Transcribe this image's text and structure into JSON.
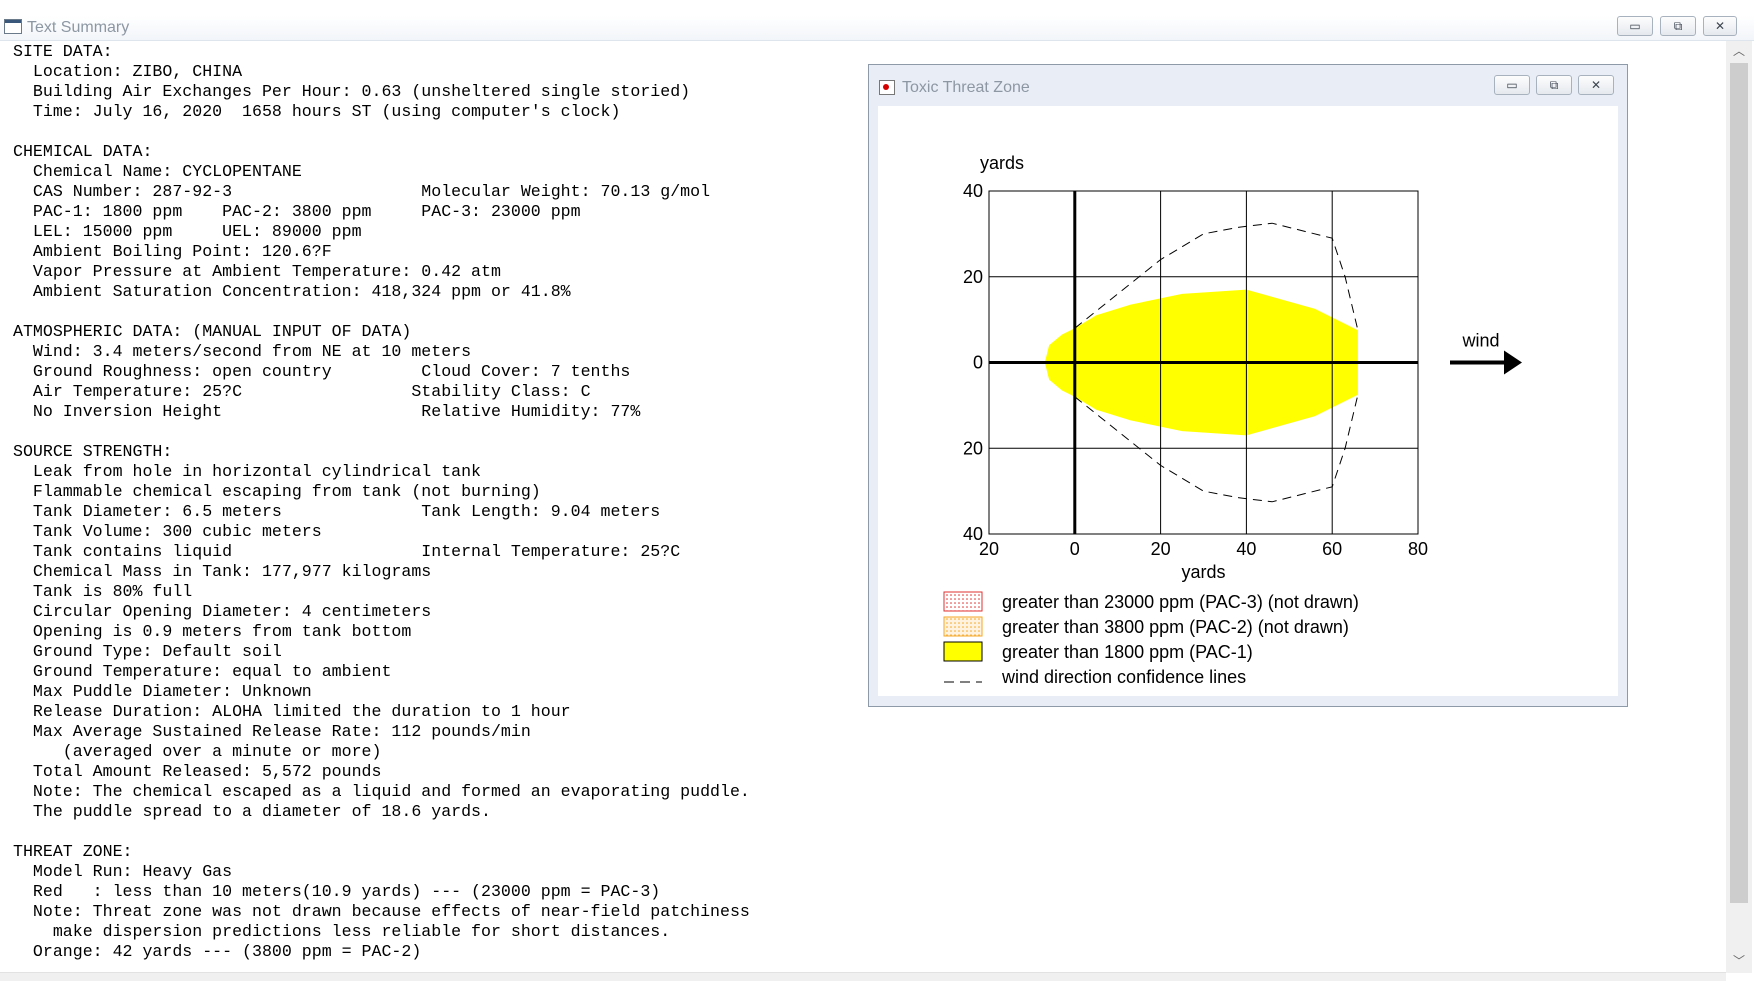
{
  "main_window": {
    "title": "Text Summary",
    "controls": {
      "minimize": "▭",
      "restore": "⧉",
      "close": "✕"
    }
  },
  "text_summary": {
    "lines": [
      "SITE DATA:",
      "  Location: ZIBO, CHINA",
      "  Building Air Exchanges Per Hour: 0.63 (unsheltered single storied)",
      "  Time: July 16, 2020  1658 hours ST (using computer's clock)",
      "",
      "CHEMICAL DATA:",
      "  Chemical Name: CYCLOPENTANE",
      "  CAS Number: 287-92-3                   Molecular Weight: 70.13 g/mol",
      "  PAC-1: 1800 ppm    PAC-2: 3800 ppm     PAC-3: 23000 ppm",
      "  LEL: 15000 ppm     UEL: 89000 ppm",
      "  Ambient Boiling Point: 120.6?F",
      "  Vapor Pressure at Ambient Temperature: 0.42 atm",
      "  Ambient Saturation Concentration: 418,324 ppm or 41.8%",
      "",
      "ATMOSPHERIC DATA: (MANUAL INPUT OF DATA)",
      "  Wind: 3.4 meters/second from NE at 10 meters",
      "  Ground Roughness: open country         Cloud Cover: 7 tenths",
      "  Air Temperature: 25?C                 Stability Class: C",
      "  No Inversion Height                    Relative Humidity: 77%",
      "",
      "SOURCE STRENGTH:",
      "  Leak from hole in horizontal cylindrical tank",
      "  Flammable chemical escaping from tank (not burning)",
      "  Tank Diameter: 6.5 meters              Tank Length: 9.04 meters",
      "  Tank Volume: 300 cubic meters",
      "  Tank contains liquid                   Internal Temperature: 25?C",
      "  Chemical Mass in Tank: 177,977 kilograms",
      "  Tank is 80% full",
      "  Circular Opening Diameter: 4 centimeters",
      "  Opening is 0.9 meters from tank bottom",
      "  Ground Type: Default soil",
      "  Ground Temperature: equal to ambient",
      "  Max Puddle Diameter: Unknown",
      "  Release Duration: ALOHA limited the duration to 1 hour",
      "  Max Average Sustained Release Rate: 112 pounds/min",
      "     (averaged over a minute or more)",
      "  Total Amount Released: 5,572 pounds",
      "  Note: The chemical escaped as a liquid and formed an evaporating puddle.",
      "  The puddle spread to a diameter of 18.6 yards.",
      "",
      "THREAT ZONE:",
      "  Model Run: Heavy Gas",
      "  Red   : less than 10 meters(10.9 yards) --- (23000 ppm = PAC-3)",
      "  Note: Threat zone was not drawn because effects of near-field patchiness",
      "    make dispersion predictions less reliable for short distances.",
      "  Orange: 42 yards --- (3800 ppm = PAC-2)"
    ]
  },
  "threat_window": {
    "title": "Toxic Threat Zone",
    "controls": {
      "minimize": "▭",
      "restore": "⧉",
      "close": "✕"
    }
  },
  "chart_data": {
    "type": "area",
    "xlabel": "yards",
    "ylabel": "yards",
    "xlim": [
      -20,
      80
    ],
    "ylim": [
      -40,
      40
    ],
    "x_ticks": [
      -20,
      0,
      20,
      40,
      60,
      80
    ],
    "x_tick_labels": [
      "20",
      "0",
      "20",
      "40",
      "60",
      "80"
    ],
    "y_ticks": [
      40,
      20,
      0,
      -20,
      -40
    ],
    "y_tick_labels": [
      "40",
      "20",
      "0",
      "20",
      "40"
    ],
    "grid": true,
    "wind_label": "wind",
    "pac1_zone": {
      "name": "greater than 1800 ppm (PAC-1)",
      "color": "#ffff00",
      "outline": [
        [
          -7,
          0
        ],
        [
          -6,
          4
        ],
        [
          -3,
          6.5
        ],
        [
          0,
          8
        ],
        [
          5,
          11
        ],
        [
          13,
          13.5
        ],
        [
          25,
          16
        ],
        [
          40,
          17
        ],
        [
          56,
          12.5
        ],
        [
          66,
          7.5
        ],
        [
          66,
          -7.5
        ],
        [
          56,
          -12.5
        ],
        [
          40,
          -17
        ],
        [
          25,
          -16
        ],
        [
          13,
          -13.5
        ],
        [
          5,
          -11
        ],
        [
          0,
          -8
        ],
        [
          -3,
          -6.5
        ],
        [
          -6,
          -4
        ]
      ]
    },
    "confidence_lines": {
      "name": "wind direction confidence lines",
      "upper": [
        [
          0,
          8
        ],
        [
          10,
          16
        ],
        [
          20,
          24
        ],
        [
          30,
          30
        ],
        [
          38,
          31.5
        ],
        [
          46,
          32.5
        ],
        [
          60,
          29
        ],
        [
          63,
          20
        ],
        [
          66,
          7.5
        ]
      ],
      "lower": [
        [
          0,
          -8
        ],
        [
          10,
          -16
        ],
        [
          20,
          -24
        ],
        [
          30,
          -30
        ],
        [
          38,
          -31.5
        ],
        [
          46,
          -32.5
        ],
        [
          60,
          -29
        ],
        [
          63,
          -20
        ],
        [
          66,
          -7.5
        ]
      ]
    },
    "legend": [
      {
        "label": "greater than 23000 ppm (PAC-3) (not drawn)",
        "swatch": "dotted-red",
        "color": "#e03030"
      },
      {
        "label": "greater than 3800 ppm (PAC-2) (not drawn)",
        "swatch": "dotted-orange",
        "color": "#f5a623"
      },
      {
        "label": "greater than 1800 ppm (PAC-1)",
        "swatch": "solid-yellow",
        "color": "#ffff00"
      },
      {
        "label": "wind direction confidence lines",
        "swatch": "dashed-line",
        "color": "#000000"
      }
    ]
  }
}
